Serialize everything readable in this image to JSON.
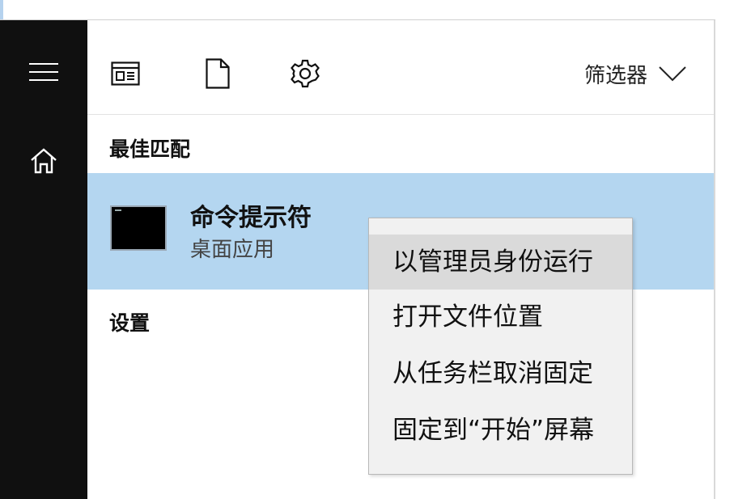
{
  "toolbar": {
    "icons": [
      "app-window-icon",
      "document-icon",
      "gear-icon"
    ],
    "filter_label": "筛选器"
  },
  "sidebar": {
    "icons": [
      "hamburger-menu-icon",
      "home-icon"
    ]
  },
  "best_match": {
    "heading": "最佳匹配",
    "app_name": "命令提示符",
    "app_type": "桌面应用",
    "highlight_color": "#b4d6f0"
  },
  "settings": {
    "heading": "设置"
  },
  "context_menu": {
    "items": [
      "以管理员身份运行",
      "打开文件位置",
      "从任务栏取消固定",
      "固定到“开始”屏幕"
    ],
    "hovered_index": 0
  }
}
